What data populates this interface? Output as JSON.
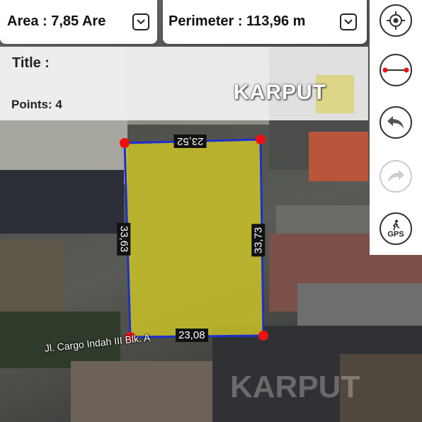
{
  "area": {
    "text": "Area : 7,85 Are"
  },
  "perimeter": {
    "text": "Perimeter : 113,96 m"
  },
  "info": {
    "title": "Title :",
    "points": "Points: 4"
  },
  "brand": "KARPUT",
  "polygon": {
    "fill": "#c9c227",
    "stroke": "#1f2fd0",
    "vertex_color": "#ee1111",
    "edges": {
      "top": "23,52",
      "right": "33,73",
      "bottom": "23,08",
      "left": "33,63"
    }
  },
  "street_label": "Jl. Cargo Indah III Blk. A",
  "tools": [
    "location-icon",
    "measure-icon",
    "undo-icon",
    "redo-icon",
    "gps-icon"
  ],
  "gps_label": "GPS"
}
